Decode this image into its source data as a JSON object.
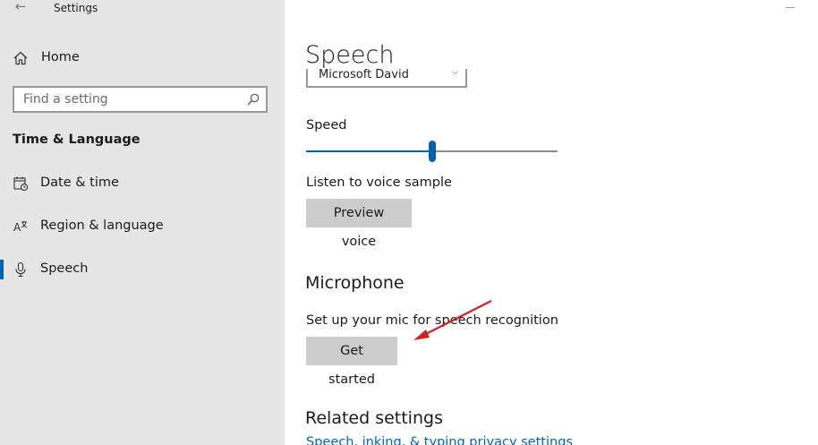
{
  "window": {
    "title": "Settings"
  },
  "sidebar": {
    "home_label": "Home",
    "search_placeholder": "Find a setting",
    "section_heading": "Time & Language",
    "items": [
      {
        "label": "Date & time",
        "icon": "calendar-clock-icon",
        "active": false
      },
      {
        "label": "Region & language",
        "icon": "language-icon",
        "active": false
      },
      {
        "label": "Speech",
        "icon": "microphone-icon",
        "active": true
      }
    ]
  },
  "main": {
    "page_title": "Speech",
    "voice_select_value": "Microsoft David",
    "speed_label": "Speed",
    "speed_value_fraction": 0.5,
    "listen_label": "Listen to voice sample",
    "preview_button": "Preview voice",
    "microphone_heading": "Microphone",
    "microphone_description": "Set up your mic for speech recognition",
    "get_started_button": "Get started",
    "related_heading": "Related settings",
    "related_link": "Speech, inking, & typing privacy settings"
  },
  "colors": {
    "accent": "#0063b1",
    "sidebar_bg": "#e6e6e6",
    "button_bg": "#cccccc",
    "annotation_arrow": "#d42020"
  }
}
